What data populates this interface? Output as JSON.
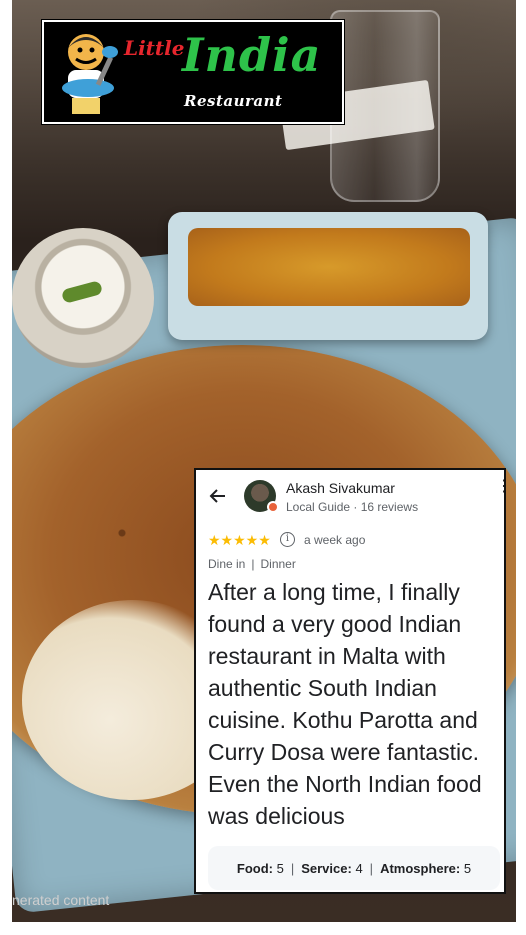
{
  "logo": {
    "little": "Little",
    "india": "India",
    "restaurant": "Restaurant"
  },
  "footer_label": "nerated content",
  "review": {
    "reviewer_name": "Akash Sivakumar",
    "reviewer_meta": "Local Guide · 16 reviews",
    "rating": 5,
    "stars": "★★★★★",
    "time": "a week ago",
    "tags": [
      "Dine in",
      "Dinner"
    ],
    "text": "After a long time, I finally found a very good Indian restaurant in Malta with authentic South Indian cuisine. Kothu Parotta and Curry Dosa were fantastic. Even the North Indian food was delicious",
    "ratings": [
      {
        "label": "Food:",
        "value": "5"
      },
      {
        "label": "Service:",
        "value": "4"
      },
      {
        "label": "Atmosphere:",
        "value": "5"
      }
    ]
  }
}
